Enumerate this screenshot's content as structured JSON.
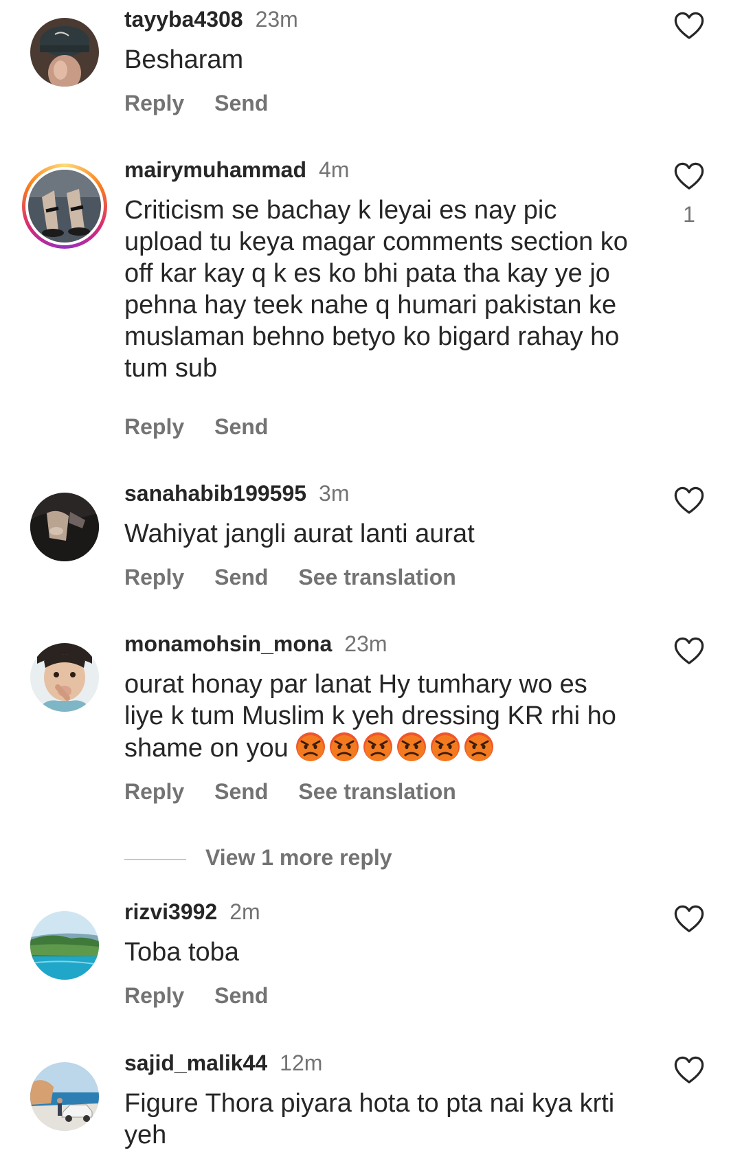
{
  "colors": {
    "text_primary": "#262626",
    "text_secondary": "#737373",
    "story_ring": "#d62976"
  },
  "actions": {
    "reply": "Reply",
    "send": "Send",
    "see_translation": "See translation"
  },
  "comments": [
    {
      "username": "tayyba4308",
      "time": "23m",
      "text": "Besharam",
      "like_count": "",
      "avatar_icon": "avatar-cap-icon"
    },
    {
      "username": "mairymuhammad",
      "time": "4m",
      "text": "Criticism se bachay k leyai es nay pic upload tu keya magar comments  section ko off kar kay q k es ko bhi pata tha kay ye jo pehna hay teek nahe q humari pakistan ke muslaman behno betyo ko bigard rahay ho tum sub",
      "like_count": "1",
      "avatar_icon": "avatar-sandals-icon"
    },
    {
      "username": "sanahabib199595",
      "time": "3m",
      "text": "Wahiyat jangli aurat lanti aurat",
      "like_count": "",
      "avatar_icon": "avatar-dark-icon"
    },
    {
      "username": "monamohsin_mona",
      "time": "23m",
      "text": "ourat honay par lanat Hy tumhary wo es liye k tum Muslim k yeh dressing KR rhi ho shame on you",
      "emoji": [
        "angry-face-icon",
        "angry-face-icon",
        "angry-face-icon",
        "angry-face-icon",
        "angry-face-icon",
        "angry-face-icon"
      ],
      "like_count": "",
      "avatar_icon": "avatar-child-icon"
    },
    {
      "username": "rizvi3992",
      "time": "2m",
      "text": "Toba toba",
      "like_count": "",
      "avatar_icon": "avatar-landscape-icon"
    },
    {
      "username": "sajid_malik44",
      "time": "12m",
      "text": "Figure Thora piyara hota to pta nai kya krti yeh",
      "like_count": "",
      "avatar_icon": "avatar-car-beach-icon"
    }
  ],
  "view_more_replies": "View 1 more reply"
}
